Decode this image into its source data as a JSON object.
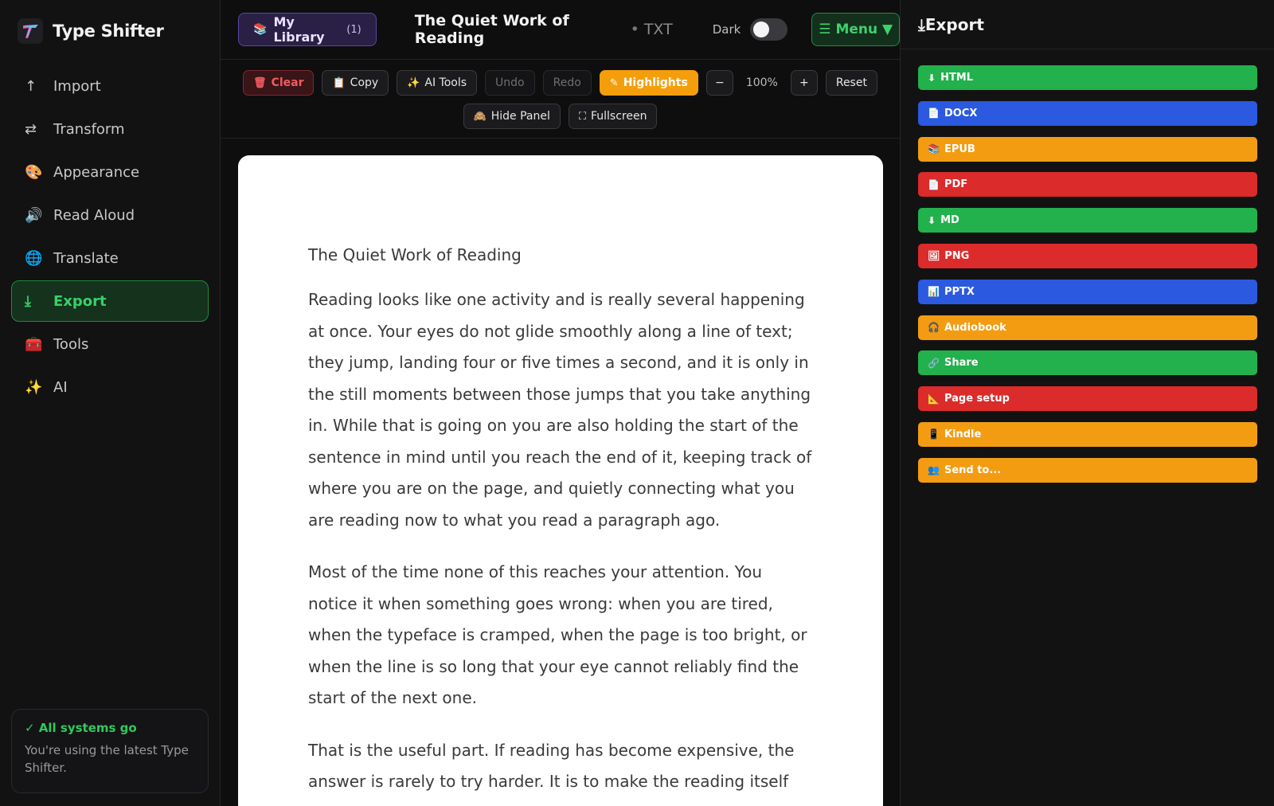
{
  "sidebar": {
    "brand": "Type Shifter",
    "items": [
      {
        "label": "Import",
        "icon": "↑",
        "active": false
      },
      {
        "label": "Transform",
        "icon": "⇄",
        "active": false
      },
      {
        "label": "Appearance",
        "icon": "🎨",
        "active": false
      },
      {
        "label": "Read Aloud",
        "icon": "🔊",
        "active": false
      },
      {
        "label": "Translate",
        "icon": "🌐",
        "active": false
      },
      {
        "label": "Export",
        "icon": "⤓",
        "active": true
      },
      {
        "label": "Tools",
        "icon": "🧰",
        "active": false
      },
      {
        "label": "AI",
        "icon": "✨",
        "active": false
      }
    ],
    "status": {
      "title": "✓ All systems go",
      "description": "You're using the latest Type Shifter."
    }
  },
  "topbar": {
    "library_label": "My Library",
    "library_count": "(1)",
    "doc_title": "The Quiet Work of Reading",
    "doc_type": "TXT",
    "dark_label": "Dark",
    "menu_label": "☰ Menu ▼"
  },
  "toolbar": {
    "clear": "Clear",
    "copy": "Copy",
    "ai_tools": "AI Tools",
    "undo": "Undo",
    "redo": "Redo",
    "highlights": "Highlights",
    "zoom_out": "−",
    "zoom": "100%",
    "zoom_in": "+",
    "reset": "Reset",
    "hide_panel": "Hide Panel",
    "fullscreen": "Fullscreen"
  },
  "document": {
    "title": "The Quiet Work of Reading",
    "paragraphs": [
      "Reading looks like one activity and is really several happening at once. Your eyes do not glide smoothly along a line of text; they jump, landing four or five times a second, and it is only in the still moments between those jumps that you take anything in. While that is going on you are also holding the start of the sentence in mind until you reach the end of it, keeping track of where you are on the page, and quietly connecting what you are reading now to what you read a paragraph ago.",
      "Most of the time none of this reaches your attention. You notice it when something goes wrong: when you are tired, when the typeface is cramped, when the page is too bright, or when the line is so long that your eye cannot reliably find the start of the next one.",
      "That is the useful part. If reading has become expensive, the answer is rarely to try harder. It is to make the reading itself cost"
    ]
  },
  "export_panel": {
    "title": "⤓Export",
    "buttons": [
      {
        "label": "HTML",
        "icon": "⬇",
        "color": "#22b14c"
      },
      {
        "label": "DOCX",
        "icon": "📄",
        "color": "#2b59e0"
      },
      {
        "label": "EPUB",
        "icon": "📚",
        "color": "#f39c12"
      },
      {
        "label": "PDF",
        "icon": "📄",
        "color": "#db2b2b"
      },
      {
        "label": "MD",
        "icon": "⬇",
        "color": "#22b14c"
      },
      {
        "label": "PNG",
        "icon": "🖼",
        "color": "#db2b2b"
      },
      {
        "label": "PPTX",
        "icon": "📊",
        "color": "#2b59e0"
      },
      {
        "label": "Audiobook",
        "icon": "🎧",
        "color": "#f39c12"
      },
      {
        "label": "Share",
        "icon": "🔗",
        "color": "#22b14c"
      },
      {
        "label": "Page setup",
        "icon": "📐",
        "color": "#db2b2b"
      },
      {
        "label": "Kindle",
        "icon": "📱",
        "color": "#f39c12"
      },
      {
        "label": "Send to...",
        "icon": "👥",
        "color": "#f39c12"
      }
    ]
  }
}
